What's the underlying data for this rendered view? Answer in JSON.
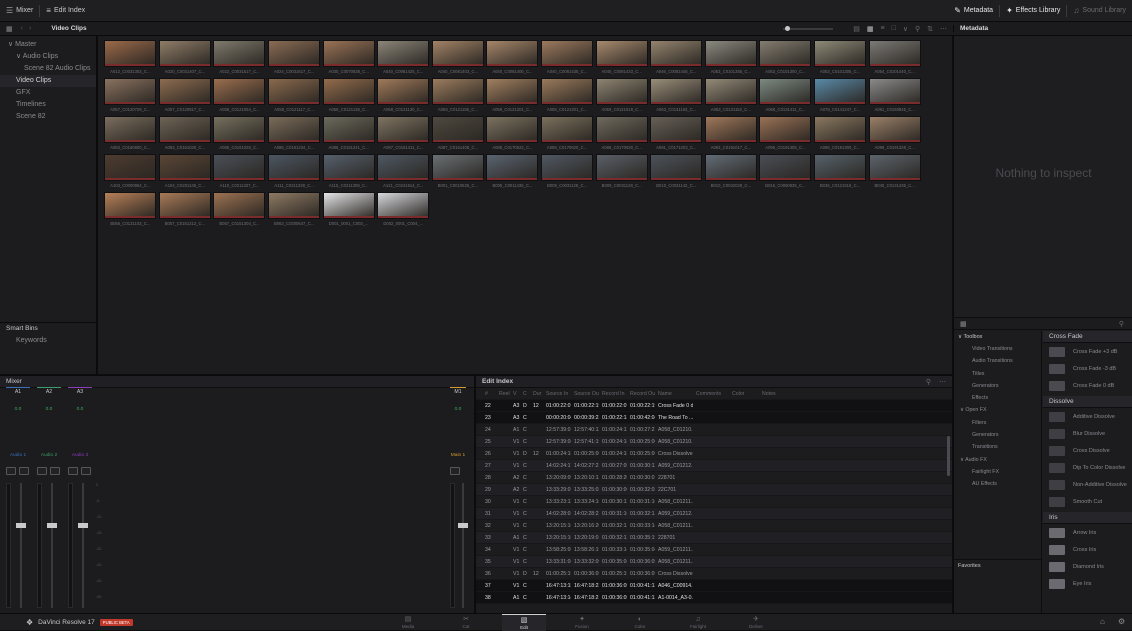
{
  "topbar": {
    "mixer_label": "Mixer",
    "edit_index_label": "Edit Index",
    "metadata_label": "Metadata",
    "effects_library_label": "Effects Library",
    "sound_library_label": "Sound Library"
  },
  "subbar": {
    "title": "Video Clips",
    "inspector_title": "Metadata"
  },
  "bins": {
    "master": "Master",
    "items": [
      {
        "label": "Audio Clips",
        "level": 1,
        "selected": false
      },
      {
        "label": "Scene 82 Audio Clips",
        "level": 2,
        "selected": false
      },
      {
        "label": "Video Clips",
        "level": 1,
        "selected": true
      },
      {
        "label": "GFX",
        "level": 1,
        "selected": false
      },
      {
        "label": "Timelines",
        "level": 1,
        "selected": false
      },
      {
        "label": "Scene 82",
        "level": 1,
        "selected": false
      }
    ],
    "smart_bins": "Smart Bins",
    "keywords": "Keywords"
  },
  "clips": [
    {
      "name": "A012_C0031303_C...",
      "tone": "#9c6a4a"
    },
    {
      "name": "A020_C0031407_C...",
      "tone": "#8f7d68"
    },
    {
      "name": "A022_C0031517_C...",
      "tone": "#7f7a6c"
    },
    {
      "name": "A024_C0031617_C...",
      "tone": "#8a6c54"
    },
    {
      "name": "A030_C0070838_C...",
      "tone": "#9a7356"
    },
    {
      "name": "A040_C0081425_C...",
      "tone": "#8b8579"
    },
    {
      "name": "A040_C0081403_C...",
      "tone": "#a28366"
    },
    {
      "name": "A040_C0081400_C...",
      "tone": "#a6866a"
    },
    {
      "name": "A040_C0081435_C...",
      "tone": "#9c7a5e"
    },
    {
      "name": "A040_C0081433_C...",
      "tone": "#a78a6e"
    },
    {
      "name": "A046_C0081446_C...",
      "tone": "#94846e"
    },
    {
      "name": "A053_C0101355_C...",
      "tone": "#8c8a80"
    },
    {
      "name": "A053_C0101300_C...",
      "tone": "#847d70"
    },
    {
      "name": "A053_C0101305_C...",
      "tone": "#8d8a78"
    },
    {
      "name": "A054_C0101440_C...",
      "tone": "#7c7a76"
    },
    {
      "name": "A057_C0120729_C...",
      "tone": "#8a7260"
    },
    {
      "name": "A057_C0120817_C...",
      "tone": "#8d6c50"
    },
    {
      "name": "A058_C0121054_C...",
      "tone": "#9a6e4e"
    },
    {
      "name": "A058_C0121117_C...",
      "tone": "#8a6a4e"
    },
    {
      "name": "A058_C0121138_C...",
      "tone": "#936c4c"
    },
    {
      "name": "A058_C0121130_C...",
      "tone": "#a07a5a"
    },
    {
      "name": "A059_C0121155_C...",
      "tone": "#9b7c5e"
    },
    {
      "name": "A059_C0121201_C...",
      "tone": "#a28060"
    },
    {
      "name": "A059_C0121201_C...",
      "tone": "#9a7a5c"
    },
    {
      "name": "A059_C0121519_C...",
      "tone": "#8e8472"
    },
    {
      "name": "A063_C0131153_C...",
      "tone": "#9a8e7a"
    },
    {
      "name": "A063_C0131152_C...",
      "tone": "#948a78"
    },
    {
      "name": "A068_C0131411_C...",
      "tone": "#7c8a82"
    },
    {
      "name": "A078_C0141247_C...",
      "tone": "#5a8aa8"
    },
    {
      "name": "A081_C0160845_C...",
      "tone": "#8a8a8a"
    },
    {
      "name": "A083_C0160800_C...",
      "tone": "#7a6e5e"
    },
    {
      "name": "A083_C0161030_C...",
      "tone": "#6e6456"
    },
    {
      "name": "A085_C0161028_C...",
      "tone": "#76705e"
    },
    {
      "name": "A086_C0161234_C...",
      "tone": "#7a6c5a"
    },
    {
      "name": "A086_C0161241_C...",
      "tone": "#6c6a5c"
    },
    {
      "name": "A087_C0161411_C...",
      "tone": "#7e7462"
    },
    {
      "name": "A087_C0161408_C...",
      "tone": "#4e4a40"
    },
    {
      "name": "A088_C0170622_C...",
      "tone": "#7c7260"
    },
    {
      "name": "A088_C0170620_C...",
      "tone": "#7a705c"
    },
    {
      "name": "A088_C0170630_C...",
      "tone": "#6e6a5e"
    },
    {
      "name": "A091_C0171203_C...",
      "tone": "#666056"
    },
    {
      "name": "A093_C0191017_C...",
      "tone": "#a0785a"
    },
    {
      "name": "A095_C0191305_C...",
      "tone": "#9a7256"
    },
    {
      "name": "A096_C0191300_C...",
      "tone": "#8a7860"
    },
    {
      "name": "A099_C0191328_C...",
      "tone": "#9a8068"
    },
    {
      "name": "A103_C0000954_C...",
      "tone": "#4e3c30"
    },
    {
      "name": "A104_C0201135_C...",
      "tone": "#5a4636"
    },
    {
      "name": "A110_C0211337_C...",
      "tone": "#4a5058"
    },
    {
      "name": "A111_C0211338_C...",
      "tone": "#4c5662"
    },
    {
      "name": "A115_C0211308_C...",
      "tone": "#56606c"
    },
    {
      "name": "A121_C0241614_C...",
      "tone": "#4e5862"
    },
    {
      "name": "B001_C0010635_C...",
      "tone": "#6a7074"
    },
    {
      "name": "B005_C0011435_C...",
      "tone": "#5a6470"
    },
    {
      "name": "B009_C0031128_C...",
      "tone": "#505862"
    },
    {
      "name": "B009_C0031128_C...",
      "tone": "#5a6068"
    },
    {
      "name": "B010_C0031142_C...",
      "tone": "#4c525a"
    },
    {
      "name": "B010_C0032028_C...",
      "tone": "#626c76"
    },
    {
      "name": "B016_C0060935_C...",
      "tone": "#4a4e56"
    },
    {
      "name": "B036_C0121515_C...",
      "tone": "#56626a"
    },
    {
      "name": "B040_C0131436_C...",
      "tone": "#5c646c"
    },
    {
      "name": "B056_C0131103_C...",
      "tone": "#b88058"
    },
    {
      "name": "B057_C0151212_C...",
      "tone": "#a87a58"
    },
    {
      "name": "B057_C0151304_C...",
      "tone": "#9c7252"
    },
    {
      "name": "B063_C0200647_C...",
      "tone": "#8e7a64"
    },
    {
      "name": "D001_0001_C003_...",
      "tone": "#e4e4e6"
    },
    {
      "name": "D002_0001_C004_...",
      "tone": "#d6d8dc"
    }
  ],
  "inspector": {
    "empty_text": "Nothing to inspect"
  },
  "mixer": {
    "title": "Mixer",
    "tracks": [
      "A1",
      "A2",
      "A3"
    ],
    "track_gain": [
      "0.0",
      "0.0",
      "0.0"
    ],
    "track_colors": [
      "#3b6fb6",
      "#3b9b6a",
      "#8a3bb6"
    ],
    "bus_label": "M1",
    "bus_gain": "0.0",
    "channel_names": [
      "Audio 1",
      "Audio 2",
      "Audio 3"
    ],
    "main_name": "Main 1",
    "main_color": "#d99a2a",
    "scale": [
      "0",
      "-5",
      "-10",
      "-15",
      "-20",
      "-30",
      "-40",
      "-50"
    ]
  },
  "edit_index": {
    "title": "Edit Index",
    "columns": [
      "#",
      "Reel",
      "V",
      "C",
      "Dur",
      "Source In",
      "Source Out",
      "Record In",
      "Record Out",
      "Name",
      "Comments",
      "Color",
      "Notes"
    ],
    "rows": [
      [
        "22",
        "",
        "A3",
        "D",
        "12",
        "01:00:22:07",
        "01:00:22:19",
        "01:00:22:07",
        "01:00:22:19",
        "Cross Fade 0 dB"
      ],
      [
        "23",
        "",
        "A3",
        "C",
        "",
        "00:00:20:04",
        "00:00:39:23",
        "01:00:22:13",
        "01:00:42:04",
        "The Road To ..."
      ],
      [
        "24",
        "",
        "A1",
        "C",
        "",
        "12:57:39:01",
        "12:57:40:11",
        "01:00:24:11",
        "01:00:27:22",
        "A058_C01210..."
      ],
      [
        "25",
        "",
        "V1",
        "C",
        "",
        "12:57:39:08",
        "12:57:41:19",
        "01:00:24:18",
        "01:00:25:06",
        "A058_C01210..."
      ],
      [
        "26",
        "",
        "V1",
        "D",
        "12",
        "01:00:24:18",
        "01:00:25:06",
        "01:00:24:18",
        "01:00:25:06",
        "Cross Dissolve"
      ],
      [
        "27",
        "",
        "V1",
        "C",
        "",
        "14:02:24:17",
        "14:02:27:23",
        "01:00:27:05",
        "01:00:30:11",
        "A059_C01212..."
      ],
      [
        "28",
        "",
        "A2",
        "C",
        "",
        "13:20:09:09",
        "13:20:10:13",
        "01:00:28:20",
        "01:00:30:01",
        "228701"
      ],
      [
        "29",
        "",
        "A2",
        "C",
        "",
        "13:33:29:07",
        "13:33:25:02",
        "01:00:30:06",
        "01:00:32:02",
        "22C701"
      ],
      [
        "30",
        "",
        "V1",
        "C",
        "",
        "13:33:23:11",
        "13:33:24:16",
        "01:00:30:11",
        "01:00:31:16",
        "A058_C01211..."
      ],
      [
        "31",
        "",
        "V1",
        "C",
        "",
        "14:02:28:02",
        "14:02:28:22",
        "01:00:31:16",
        "01:00:32:12",
        "A059_C01212..."
      ],
      [
        "32",
        "",
        "V1",
        "C",
        "",
        "13:20:15:16",
        "13:20:16:20",
        "01:00:32:12",
        "01:00:33:14",
        "A058_C01211..."
      ],
      [
        "33",
        "",
        "A1",
        "C",
        "",
        "13:20:15:16",
        "13:20:19:01",
        "01:00:32:12",
        "01:00:35:19",
        "228701"
      ],
      [
        "34",
        "",
        "V1",
        "C",
        "",
        "13:58:25:05",
        "13:58:26:19",
        "01:00:33:14",
        "01:00:35:04",
        "A059_C01211..."
      ],
      [
        "35",
        "",
        "V1",
        "C",
        "",
        "13:33:31:08",
        "13:33:32:09",
        "01:00:35:04",
        "01:00:36:05",
        "A058_C01211..."
      ],
      [
        "36",
        "",
        "V1",
        "D",
        "12",
        "01:00:25:19",
        "01:00:36:05",
        "01:00:25:19",
        "01:00:36:05",
        "Cross Dissolve"
      ],
      [
        "37",
        "",
        "V1",
        "C",
        "",
        "16:47:13:15",
        "16:47:18:23",
        "01:00:36:05",
        "01:00:41:13",
        "A046_C00914..."
      ],
      [
        "38",
        "",
        "A1",
        "C",
        "",
        "16:47:13:14",
        "16:47:18:21",
        "01:00:36:05",
        "01:00:41:13",
        "A1-0014_A3-0..."
      ]
    ]
  },
  "effects": {
    "toolbox": "Toolbox",
    "tree": [
      {
        "label": "Video Transitions",
        "level": 2
      },
      {
        "label": "Audio Transitions",
        "level": 2
      },
      {
        "label": "Titles",
        "level": 2
      },
      {
        "label": "Generators",
        "level": 2
      },
      {
        "label": "Effects",
        "level": 2
      },
      {
        "label": "Open FX",
        "level": 1
      },
      {
        "label": "Filters",
        "level": 2
      },
      {
        "label": "Generators",
        "level": 2
      },
      {
        "label": "Transitions",
        "level": 2
      },
      {
        "label": "Audio FX",
        "level": 1
      },
      {
        "label": "Fairlight FX",
        "level": 2
      },
      {
        "label": "AU Effects",
        "level": 2
      }
    ],
    "favorites": "Favorites",
    "cross_fade_header": "Cross Fade",
    "cross_fades": [
      "Cross Fade +3 dB",
      "Cross Fade -3 dB",
      "Cross Fade 0 dB"
    ],
    "dissolve_header": "Dissolve",
    "dissolves": [
      "Additive Dissolve",
      "Blur Dissolve",
      "Cross Dissolve",
      "Dip To Color Dissolve",
      "Non-Additive Dissolve",
      "Smooth Cut"
    ],
    "iris_header": "Iris",
    "iris": [
      "Arrow Iris",
      "Cross Iris",
      "Diamond Iris",
      "Eye Iris"
    ]
  },
  "pagebar": {
    "app_name": "DaVinci Resolve 17",
    "badge": "PUBLIC BETA",
    "pages": [
      "Media",
      "Cut",
      "Edit",
      "Fusion",
      "Color",
      "Fairlight",
      "Deliver"
    ],
    "active_page": "Edit"
  }
}
